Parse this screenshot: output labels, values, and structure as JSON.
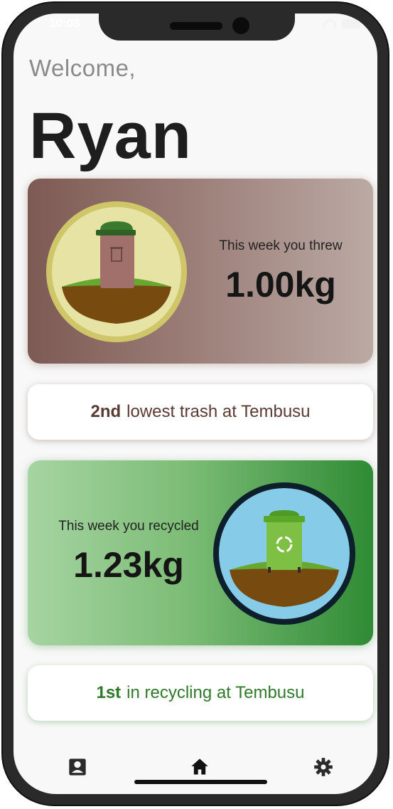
{
  "status": {
    "time": "10:08"
  },
  "greeting": {
    "welcome": "Welcome,",
    "name": "Ryan"
  },
  "trash": {
    "caption": "This week you threw",
    "value": "1.00kg",
    "rank_bold": "2nd",
    "rank_text": "lowest trash at Tembusu"
  },
  "recycle": {
    "caption": "This week you recycled",
    "value": "1.23kg",
    "rank_bold": "1st",
    "rank_text": "in recycling at Tembusu"
  },
  "nav": {
    "items": [
      {
        "icon": "profile-icon"
      },
      {
        "icon": "home-icon"
      },
      {
        "icon": "gear-icon"
      }
    ]
  },
  "colors": {
    "trash_gradient_start": "#7d5a53",
    "trash_gradient_end": "#bba9a4",
    "recycle_gradient_start": "#a6d4a2",
    "recycle_gradient_end": "#2f8b35",
    "trash_rank_text": "#5b3a33",
    "recycle_rank_text": "#2f7a2a"
  }
}
